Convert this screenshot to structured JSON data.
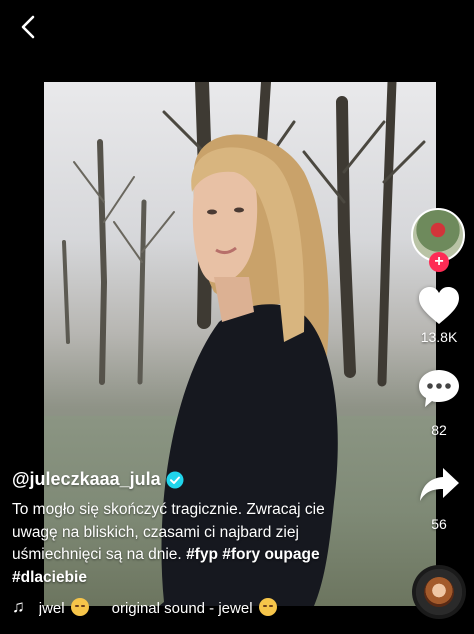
{
  "post": {
    "username": "@juleczkaaa_jula",
    "caption_text": "To mogło się skończyć tragicznie. Zwracaj cie uwagę na bliskich, czasami ci najbard ziej uśmiechnięci są na dnie.",
    "caption_tags": "#fyp #fory oupage #dlaciebie"
  },
  "actions": {
    "likes": "13.8K",
    "comments": "82",
    "shares": "56",
    "follow_symbol": "+"
  },
  "music": {
    "prefix": "jwel",
    "title": "original sound - jewel"
  },
  "icons": {
    "back": "chevron-left-icon",
    "like": "heart-icon",
    "comment": "comment-bubble-icon",
    "share": "share-arrow-icon",
    "music": "music-note-icon",
    "verified": "verified-badge-icon"
  },
  "colors": {
    "follow_accent": "#fe2c55",
    "verified": "#20d5ec"
  }
}
